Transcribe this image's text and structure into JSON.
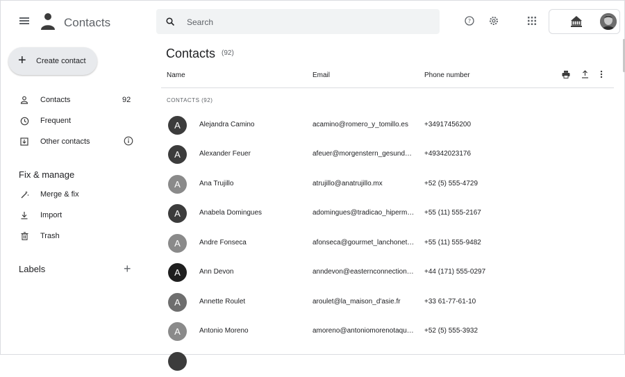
{
  "app": {
    "title": "Contacts",
    "menu_icon": "hamburger-menu-icon",
    "logo_icon": "contacts-person-icon"
  },
  "search": {
    "placeholder": "Search",
    "value": ""
  },
  "top_icons": [
    "help-icon",
    "settings-icon",
    "apps-grid-icon",
    "org-logo-icon",
    "account-avatar"
  ],
  "sidebar": {
    "create_label": "Create contact",
    "items": [
      {
        "label": "Contacts",
        "count": "92",
        "icon": "person-icon"
      },
      {
        "label": "Frequent",
        "count": "",
        "icon": "history-icon"
      },
      {
        "label": "Other contacts",
        "count": "",
        "icon": "other-contacts-icon"
      }
    ],
    "fix_manage_heading": "Fix & manage",
    "fix_items": [
      {
        "label": "Merge & fix",
        "icon": "magic-wand-icon"
      },
      {
        "label": "Import",
        "icon": "download-icon"
      },
      {
        "label": "Trash",
        "icon": "trash-icon"
      }
    ],
    "labels_heading": "Labels"
  },
  "main": {
    "title": "Contacts",
    "title_count": "(92)",
    "columns": {
      "name": "Name",
      "email": "Email",
      "phone": "Phone number"
    },
    "group_label": "CONTACTS (92)",
    "rows": [
      {
        "initial": "A",
        "name": "Alejandra Camino",
        "email": "acamino@romero_y_tomillo.es",
        "phone": "+34917456200",
        "avatar_color": "#3c3c3c"
      },
      {
        "initial": "A",
        "name": "Alexander Feuer",
        "email": "afeuer@morgenstern_gesund…",
        "phone": "+49342023176",
        "avatar_color": "#3c3c3c"
      },
      {
        "initial": "A",
        "name": "Ana Trujillo",
        "email": "atrujillo@anatrujillo.mx",
        "phone": "+52 (5) 555-4729",
        "avatar_color": "#8a8a8a"
      },
      {
        "initial": "A",
        "name": "Anabela Domingues",
        "email": "adomingues@tradicao_hiperm…",
        "phone": "+55 (11) 555-2167",
        "avatar_color": "#3c3c3c"
      },
      {
        "initial": "A",
        "name": "Andre Fonseca",
        "email": "afonseca@gourmet_lanchonet…",
        "phone": "+55 (11) 555-9482",
        "avatar_color": "#8a8a8a"
      },
      {
        "initial": "A",
        "name": "Ann Devon",
        "email": "anndevon@easternconnection…",
        "phone": "+44 (171) 555-0297",
        "avatar_color": "#1f1f1f"
      },
      {
        "initial": "A",
        "name": "Annette Roulet",
        "email": "aroulet@la_maison_d'asie.fr",
        "phone": "+33 61-77-61-10",
        "avatar_color": "#6e6e6e"
      },
      {
        "initial": "A",
        "name": "Antonio Moreno",
        "email": "amoreno@antoniomorenotaqu…",
        "phone": "+52 (5) 555-3932",
        "avatar_color": "#8a8a8a"
      }
    ]
  }
}
